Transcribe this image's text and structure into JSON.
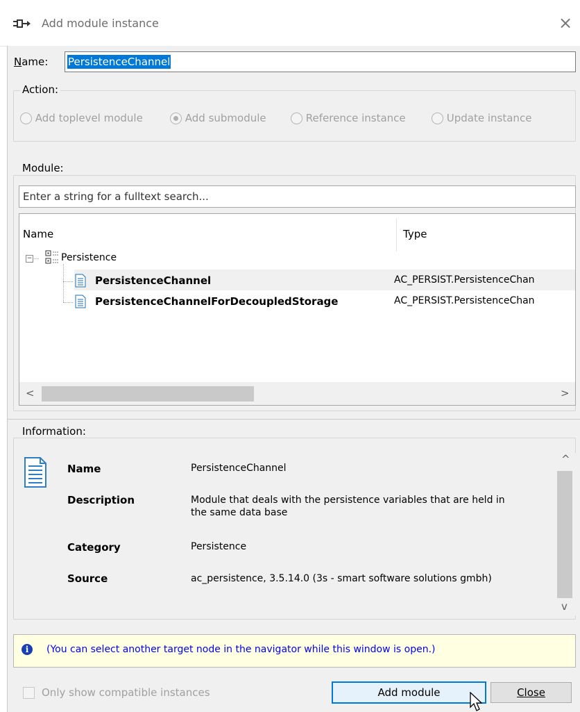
{
  "window": {
    "title": "Add module instance",
    "close_glyph": "×"
  },
  "name": {
    "label": "Name:",
    "label_rest": "ame:",
    "label_mnemonic": "N",
    "value": "PersistenceChannel"
  },
  "action": {
    "label": "Action:",
    "options": [
      {
        "label": "Add toplevel module",
        "selected": false
      },
      {
        "label": "Add submodule",
        "selected": true
      },
      {
        "label": "Reference instance",
        "selected": false
      },
      {
        "label": "Update instance",
        "selected": false
      }
    ]
  },
  "module": {
    "label": "Module:",
    "search_placeholder": "Enter a string for a fulltext search...",
    "columns": [
      "Name",
      "Type"
    ],
    "tree": {
      "root_label": "Persistence",
      "items": [
        {
          "name": "PersistenceChannel",
          "type": "AC_PERSIST.PersistenceChan"
        },
        {
          "name": "PersistenceChannelForDecoupledStorage",
          "type": "AC_PERSIST.PersistenceChan"
        }
      ]
    },
    "scroll_left": "<",
    "scroll_right": ">"
  },
  "information": {
    "label": "Information:",
    "rows": [
      {
        "key": "Name",
        "value": "PersistenceChannel"
      },
      {
        "key": "Description",
        "value": "Module that deals with the persistence variables that are held in the same data base"
      },
      {
        "key": "Category",
        "value": "Persistence"
      },
      {
        "key": "Source",
        "value": "ac_persistence, 3.5.14.0 (3s - smart software solutions gmbh)"
      }
    ],
    "scroll_up": "^",
    "scroll_down": "v"
  },
  "notice": {
    "text": "(You can select another target node in the navigator while this window is open.)"
  },
  "footer": {
    "checkbox_label": "Only show compatible instances",
    "add_button": "Add module",
    "close_button": "Close"
  },
  "colors": {
    "selection": "#0078d7",
    "notice_bg": "#ffffe1",
    "notice_text": "#0000ff",
    "disabled_text": "#a0a0a0"
  }
}
